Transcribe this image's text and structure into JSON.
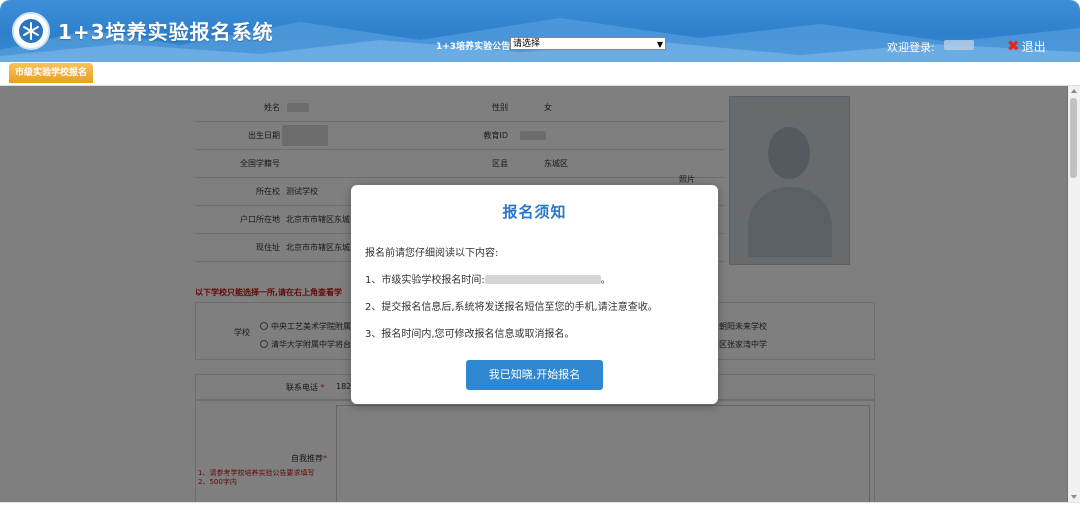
{
  "header": {
    "system_title": "1+3培养实验报名系统",
    "announcement_label": "1+3培养实验公告:",
    "announcement_select_value": "请选择",
    "welcome_text": "欢迎登录:",
    "logout_label": "退出"
  },
  "tabs": [
    {
      "label": "市级实验学校报名"
    }
  ],
  "form": {
    "name_label": "姓名",
    "gender_label": "性别",
    "gender_value": "女",
    "birth_label": "出生日期",
    "eduid_label": "教育ID",
    "student_no_label": "全国学籍号",
    "district_label": "区县",
    "district_value": "东城区",
    "school_label": "所在校",
    "school_value": "测试学校",
    "hukou_label": "户口所在地",
    "hukou_value": "北京市市辖区东城",
    "address_label": "现住址",
    "address_value": "北京市市辖区东城",
    "photo_label": "照片",
    "red_notice": "以下学校只能选择一所,请在右上角查看学",
    "school_choice_label": "学校",
    "school_options": [
      "中央工艺美术学院附属",
      "清华大学附属中学将台",
      "朝阳未来学校",
      "区张家湾中学"
    ],
    "phone_label": "联系电话",
    "phone_value": "182",
    "self_intro_label": "自我推荐",
    "self_intro_note_1": "1、请参考学校培养实验公告要求填写",
    "self_intro_note_2": "2、500字内"
  },
  "modal": {
    "title": "报名须知",
    "intro": "报名前请您仔细阅读以下内容:",
    "item1_prefix": "1、市级实验学校报名时间:",
    "item1_suffix": "。",
    "item2": "2、提交报名信息后,系统将发送报名短信至您的手机,请注意查收。",
    "item3": "3、报名时间内,您可修改报名信息或取消报名。",
    "confirm_button": "我已知晓,开始报名"
  },
  "colors": {
    "header_blue": "#2f80cc",
    "tab_orange": "#e9a020",
    "modal_title_blue": "#2a77c9",
    "button_blue": "#2f86d1",
    "logout_red": "#e8261c"
  },
  "icons": {
    "logo": "snowflake-emblem-icon",
    "logout": "close-x-icon"
  }
}
